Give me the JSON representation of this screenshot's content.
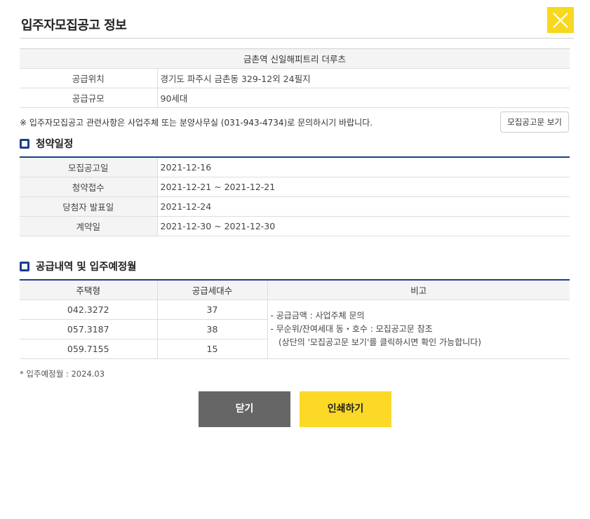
{
  "header": {
    "title": "입주자모집공고 정보"
  },
  "info": {
    "complex_name": "금촌역 신일해피트리 더루츠",
    "rows": [
      {
        "label": "공급위치",
        "value": "경기도 파주시 금촌동 329-12외 24필지"
      },
      {
        "label": "공급규모",
        "value": "90세대"
      }
    ]
  },
  "notice": {
    "text": "※ 입주자모집공고 관련사항은 사업주체 또는 분양사무실 (031-943-4734)로 문의하시기 바랍니다.",
    "view_button": "모집공고문 보기"
  },
  "schedule": {
    "title": "청약일정",
    "rows": [
      {
        "label": "모집공고일",
        "value": "2021-12-16"
      },
      {
        "label": "청약접수",
        "value": "2021-12-21 ~ 2021-12-21"
      },
      {
        "label": "당첨자 발표일",
        "value": "2021-12-24"
      },
      {
        "label": "계약일",
        "value": "2021-12-30 ~ 2021-12-30"
      }
    ]
  },
  "supply": {
    "title": "공급내역 및 입주예정월",
    "headers": [
      "주택형",
      "공급세대수",
      "비고"
    ],
    "rows": [
      {
        "type": "042.3272",
        "units": "37"
      },
      {
        "type": "057.3187",
        "units": "38"
      },
      {
        "type": "059.7155",
        "units": "15"
      }
    ],
    "remarks": [
      "-  공급금액 : 사업주체 문의",
      "-  무순위/잔여세대 동・호수 : 모집공고문 참조",
      "   (상단의 '모집공고문 보기'를 클릭하시면 확인 가능합니다)"
    ]
  },
  "footnote": "* 입주예정월 : 2024.03",
  "buttons": {
    "close": "닫기",
    "print": "인쇄하기"
  },
  "colors": {
    "accent_yellow": "#f8d81e",
    "section_blue": "#1a3f8f",
    "close_gray": "#666666"
  }
}
